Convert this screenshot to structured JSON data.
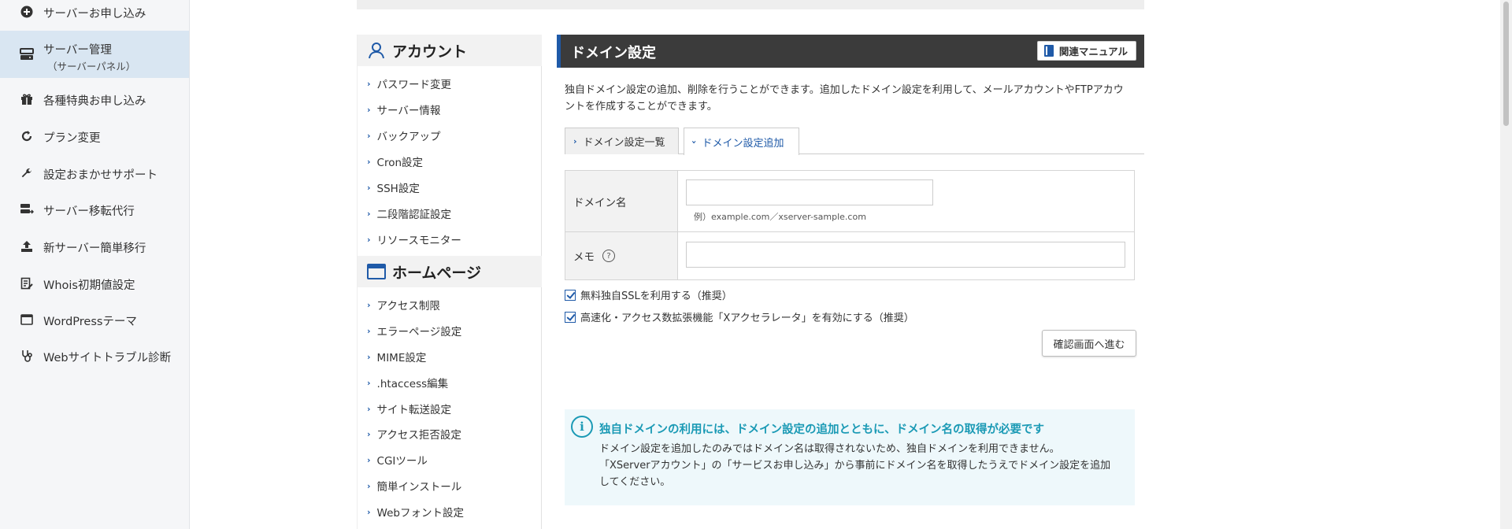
{
  "leftnav": {
    "items": [
      {
        "label": "サーバーお申し込み",
        "icon": "plus-circle-icon"
      },
      {
        "label": "サーバー管理",
        "sub": "（サーバーパネル）",
        "icon": "server-icon",
        "active": true
      },
      {
        "label": "各種特典お申し込み",
        "icon": "gift-icon"
      },
      {
        "label": "プラン変更",
        "icon": "refresh-icon"
      },
      {
        "label": "設定おまかせサポート",
        "icon": "wrench-icon"
      },
      {
        "label": "サーバー移転代行",
        "icon": "server-transfer-icon"
      },
      {
        "label": "新サーバー簡単移行",
        "icon": "upload-icon"
      },
      {
        "label": "Whois初期値設定",
        "icon": "document-edit-icon"
      },
      {
        "label": "WordPressテーマ",
        "icon": "browser-window-icon"
      },
      {
        "label": "Webサイトトラブル診断",
        "icon": "stethoscope-icon"
      }
    ]
  },
  "midmenu": {
    "account": {
      "title": "アカウント",
      "links": [
        "パスワード変更",
        "サーバー情報",
        "バックアップ",
        "Cron設定",
        "SSH設定",
        "二段階認証設定",
        "リソースモニター"
      ]
    },
    "homepage": {
      "title": "ホームページ",
      "links": [
        "アクセス制限",
        "エラーページ設定",
        "MIME設定",
        ".htaccess編集",
        "サイト転送設定",
        "アクセス拒否設定",
        "CGIツール",
        "簡単インストール",
        "Webフォント設定"
      ]
    }
  },
  "main": {
    "title": "ドメイン設定",
    "manual_label": "関連マニュアル",
    "intro_line1": "独自ドメイン設定の追加、削除を行うことができます。追加したドメイン設定を利用して、メールアカウントやFTPアカウ",
    "intro_line2": "ントを作成することができます。",
    "tabs": {
      "list": "ドメイン設定一覧",
      "add": "ドメイン設定追加"
    },
    "form": {
      "domain_label": "ドメイン名",
      "domain_value": "",
      "domain_example": "例）example.com／xserver-sample.com",
      "memo_label": "メモ",
      "memo_help": "?",
      "memo_value": ""
    },
    "checkbox_ssl": "無料独自SSLを利用する（推奨）",
    "checkbox_accel": "高速化・アクセス数拡張機能「Xアクセラレータ」を有効にする（推奨）",
    "confirm_label": "確認画面へ進む",
    "notice": {
      "title": "独自ドメインの利用には、ドメイン設定の追加とともに、ドメイン名の取得が必要です",
      "line1": "ドメイン設定を追加したのみではドメイン名は取得されないため、独自ドメインを利用できません。",
      "line2": "「XServerアカウント」の「サービスお申し込み」から事前にドメイン名を取得したうえでドメイン設定を追加",
      "line3": "してください。"
    }
  },
  "colors": {
    "accent": "#1f5aa8",
    "title_bar": "#3b3b3b",
    "notice_text": "#1b9ab5",
    "nav_active": "#d9e6f2"
  }
}
